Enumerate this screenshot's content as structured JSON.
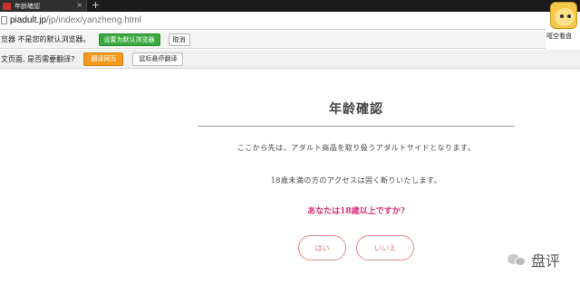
{
  "browser": {
    "tab_title": "年龄確認",
    "tab_close": "×",
    "new_tab": "+",
    "url_host": "piadult.jp",
    "url_path": "/jp/index/yanzheng.html"
  },
  "default_bar": {
    "message": "览器 不是您的默认浏览器。",
    "set_default_label": "设置为默认浏览器",
    "cancel_label": "取消"
  },
  "translate_bar": {
    "message": "文页面, 是否需要翻译?",
    "translate_label": "翻译网页",
    "keep_label": "鼠标悬停翻译"
  },
  "avatar": {
    "caption": "哐空看盘"
  },
  "page": {
    "title": "年龄確認",
    "notice_1": "ここから先は、アダルト商品を取り扱うアダルトサイドとなります。",
    "notice_2": "18歳未満の方のアクセスは固く断りいたします。",
    "question": "あなたは18歳以上ですか?",
    "yes_label": "はい",
    "no_label": "いいえ"
  },
  "watermark": {
    "text": "盘评"
  },
  "colors": {
    "accent_pink": "#d8307a",
    "button_border": "#e88a8a",
    "green_button": "#3aa93e",
    "orange_button": "#f39a1e"
  }
}
